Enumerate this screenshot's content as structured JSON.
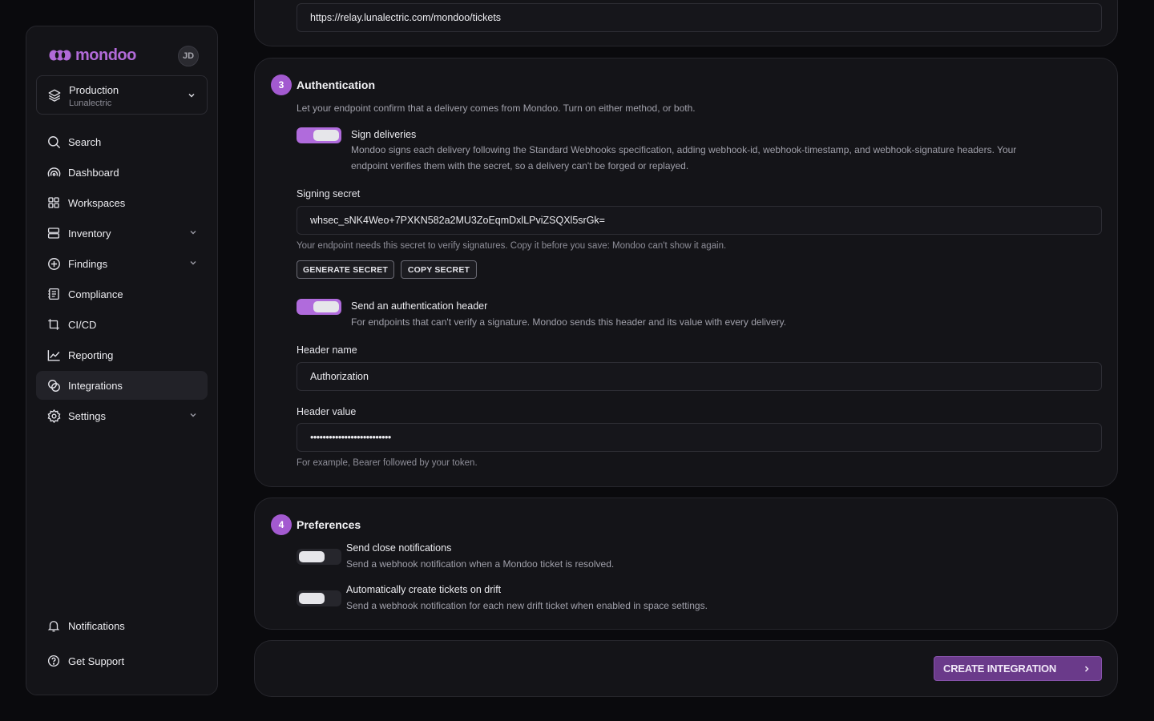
{
  "sidebar": {
    "brand": "mondoo",
    "avatar_initials": "JD",
    "space": {
      "name": "Production",
      "org": "Lunalectric"
    },
    "items": [
      {
        "label": "Search",
        "icon": "search-icon",
        "expandable": false
      },
      {
        "label": "Dashboard",
        "icon": "gauge-icon",
        "expandable": false
      },
      {
        "label": "Workspaces",
        "icon": "grid-icon",
        "expandable": false
      },
      {
        "label": "Inventory",
        "icon": "server-icon",
        "expandable": true
      },
      {
        "label": "Findings",
        "icon": "plus-circle-icon",
        "expandable": true
      },
      {
        "label": "Compliance",
        "icon": "checklist-icon",
        "expandable": false
      },
      {
        "label": "CI/CD",
        "icon": "cicd-icon",
        "expandable": false
      },
      {
        "label": "Reporting",
        "icon": "chart-line-icon",
        "expandable": false
      },
      {
        "label": "Integrations",
        "icon": "integrations-icon",
        "expandable": false,
        "active": true
      },
      {
        "label": "Settings",
        "icon": "gear-icon",
        "expandable": true
      }
    ],
    "bottom": [
      {
        "label": "Notifications",
        "icon": "bell-icon"
      },
      {
        "label": "Get Support",
        "icon": "help-circle-icon"
      }
    ]
  },
  "top_card": {
    "url_value": "https://relay.lunalectric.com/mondoo/tickets"
  },
  "auth": {
    "step": "3",
    "title": "Authentication",
    "description": "Let your endpoint confirm that a delivery comes from Mondoo. Turn on either method, or both.",
    "sign": {
      "title": "Sign deliveries",
      "desc_line1": "Mondoo signs each delivery following the Standard Webhooks specification, adding webhook-id, webhook-timestamp, and webhook-signature headers. Your",
      "desc_line2": "endpoint verifies them with the secret, so a delivery can't be forged or replayed.",
      "enabled": true
    },
    "secret_label": "Signing secret",
    "secret_value": "whsec_sNK4Weo+7PXKN582a2MU3ZoEqmDxlLPviZSQXl5srGk=",
    "secret_help": "Your endpoint needs this secret to verify signatures. Copy it before you save: Mondoo can't show it again.",
    "generate_label": "GENERATE SECRET",
    "copy_label": "COPY SECRET",
    "header": {
      "title": "Send an authentication header",
      "desc": "For endpoints that can't verify a signature. Mondoo sends this header and its value with every delivery.",
      "enabled": true
    },
    "header_name_label": "Header name",
    "header_name_value": "Authorization",
    "header_value_label": "Header value",
    "header_value_masked": "••••••••••••••••••••••••••",
    "header_value_help": "For example, Bearer followed by your token."
  },
  "prefs": {
    "step": "4",
    "title": "Preferences",
    "close": {
      "title": "Send close notifications",
      "desc": "Send a webhook notification when a Mondoo ticket is resolved.",
      "enabled": false
    },
    "drift": {
      "title": "Automatically create tickets on drift",
      "desc": "Send a webhook notification for each new drift ticket when enabled in space settings.",
      "enabled": false
    }
  },
  "footer": {
    "create_label": "CREATE INTEGRATION"
  },
  "colors": {
    "accent": "#b06bdc",
    "primary_button": "#6a3a8a",
    "background": "#0a0a0d",
    "card": "#141418"
  }
}
